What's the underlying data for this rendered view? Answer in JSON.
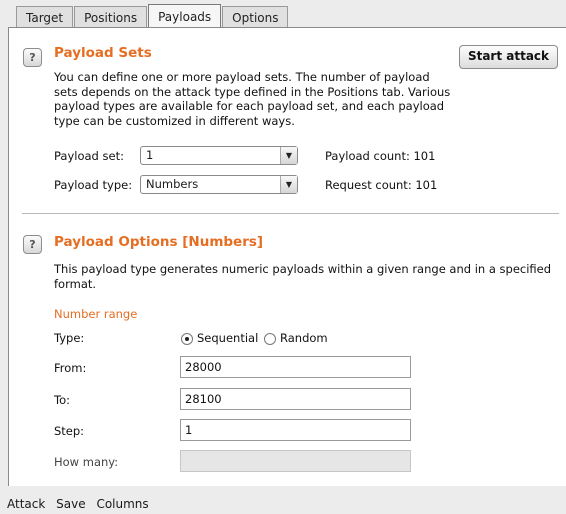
{
  "tabs": [
    {
      "label": "Target"
    },
    {
      "label": "Positions"
    },
    {
      "label": "Payloads"
    },
    {
      "label": "Options"
    }
  ],
  "payload_sets": {
    "title": "Payload Sets",
    "help_icon": "?",
    "start_button": "Start attack",
    "description": "You can define one or more payload sets. The number of payload sets depends on the attack type defined in the Positions tab. Various payload types are available for each payload set, and each payload type can be customized in different ways.",
    "set_label": "Payload set:",
    "set_value": "1",
    "type_label": "Payload type:",
    "type_value": "Numbers",
    "payload_count": "Payload count: 101",
    "request_count": "Request count: 101"
  },
  "payload_options": {
    "title": "Payload Options [Numbers]",
    "help_icon": "?",
    "description": "This payload type generates numeric payloads within a given range and in a specified format.",
    "range_heading": "Number range",
    "type_label": "Type:",
    "sequential": "Sequential",
    "random": "Random",
    "from_label": "From:",
    "from_value": "28000",
    "to_label": "To:",
    "to_value": "28100",
    "step_label": "Step:",
    "step_value": "1",
    "howmany_label": "How many:",
    "howmany_value": ""
  },
  "menu": {
    "attack": "Attack",
    "save": "Save",
    "columns": "Columns"
  },
  "colors": {
    "accent": "#e56e23"
  },
  "icons": {
    "help": "help-icon",
    "dropdown": "chevron-down-icon"
  }
}
